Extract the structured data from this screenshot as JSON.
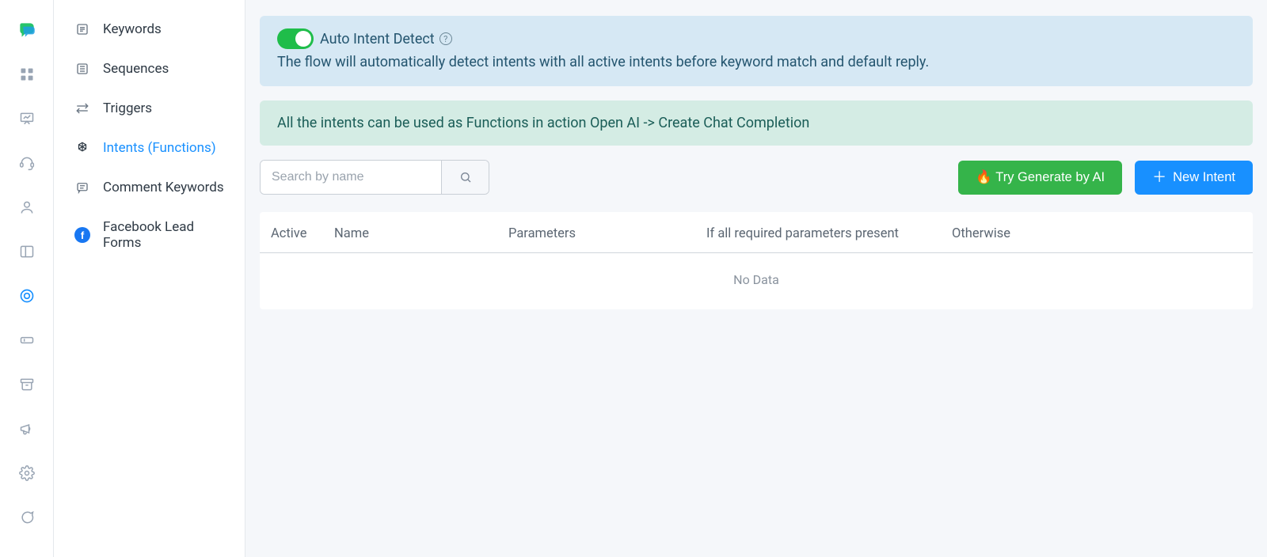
{
  "sidebar": {
    "items": [
      {
        "label": "Keywords",
        "icon": "list-icon"
      },
      {
        "label": "Sequences",
        "icon": "sequence-icon"
      },
      {
        "label": "Triggers",
        "icon": "trigger-icon"
      },
      {
        "label": "Intents (Functions)",
        "icon": "openai-icon",
        "active": true
      },
      {
        "label": "Comment Keywords",
        "icon": "comment-icon"
      },
      {
        "label": "Facebook Lead Forms",
        "icon": "facebook-icon"
      }
    ]
  },
  "banner_auto": {
    "toggle_label": "Auto Intent Detect",
    "desc": "The flow will automatically detect intents with all active intents before keyword match and default reply."
  },
  "banner_info": {
    "text": "All the intents can be used as Functions in action Open AI -> Create Chat Completion"
  },
  "search": {
    "placeholder": "Search by name"
  },
  "buttons": {
    "generate_ai": "🔥 Try Generate by AI",
    "new_intent": "New Intent"
  },
  "table": {
    "headers": {
      "active": "Active",
      "name": "Name",
      "parameters": "Parameters",
      "if_all": "If all required parameters present",
      "otherwise": "Otherwise"
    },
    "empty": "No Data"
  }
}
